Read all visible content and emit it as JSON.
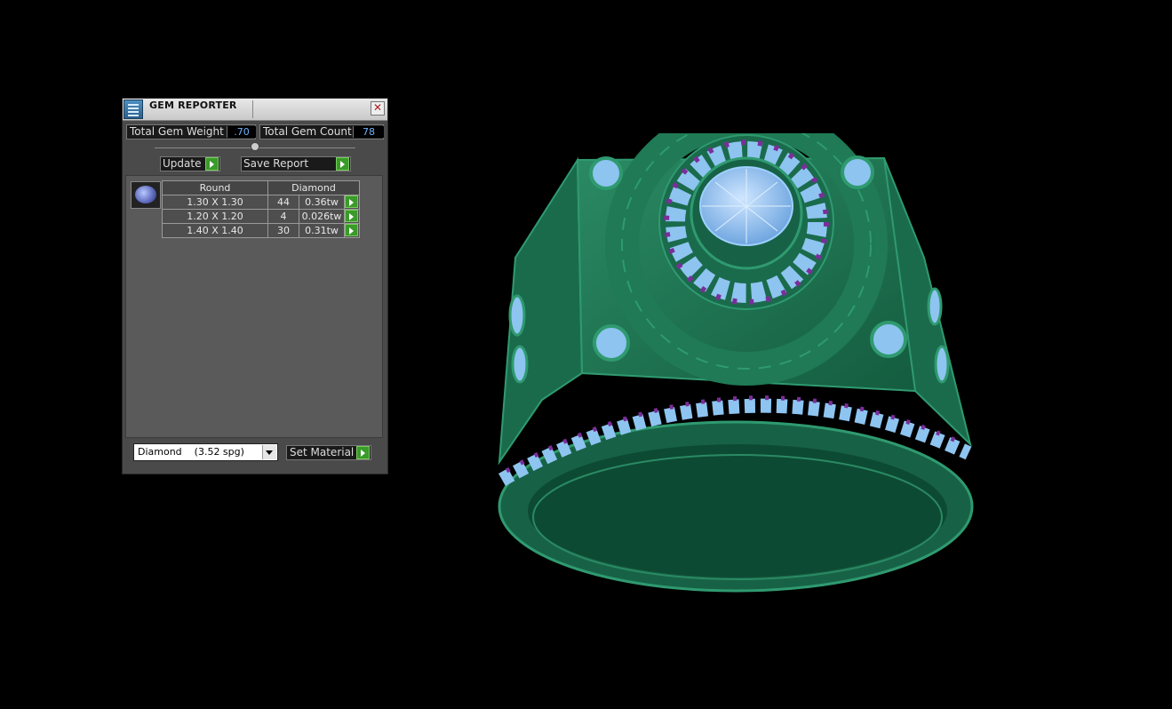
{
  "window": {
    "title": "GEM REPORTER",
    "close_glyph": "✕"
  },
  "stats": {
    "total_weight_label": "Total Gem Weight",
    "total_weight_value": ".70",
    "total_count_label": "Total Gem Count",
    "total_count_value": "78"
  },
  "toolbar": {
    "update_label": "Update",
    "save_report_label": "Save Report"
  },
  "gem_table": {
    "headers": [
      "Round",
      "Diamond"
    ],
    "rows": [
      {
        "size": "1.30 X 1.30",
        "count": "44",
        "weight": "0.36tw"
      },
      {
        "size": "1.20 X 1.20",
        "count": "4",
        "weight": "0.026tw"
      },
      {
        "size": "1.40 X 1.40",
        "count": "30",
        "weight": "0.31tw"
      }
    ]
  },
  "material": {
    "selected": "Diamond    (3.52 spg)",
    "set_label": "Set Material"
  },
  "colors": {
    "ring_metal": "#1f7a55",
    "gem_blue": "#8ec4f0",
    "gem_purple": "#7a2e9a",
    "value_text": "#6fb3ff",
    "accent_green": "#3a9a2a"
  },
  "icons": [
    "gem-reporter-app-icon",
    "close-icon",
    "slider-knob",
    "arrow-right-icon",
    "dropdown-arrow-icon",
    "round-gem-thumbnail"
  ]
}
